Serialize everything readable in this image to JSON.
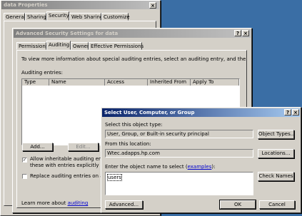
{
  "data_properties": {
    "title": "data Properties",
    "tabs": [
      "General",
      "Sharing",
      "Security",
      "Web Sharing",
      "Customize"
    ],
    "close_glyph": "×"
  },
  "advanced": {
    "title": "Advanced Security Settings for data",
    "help_glyph": "?",
    "close_glyph": "×",
    "tabs": [
      "Permissions",
      "Auditing",
      "Owner",
      "Effective Permissions"
    ],
    "instruction": "To view more information about special auditing entries, select an auditing entry, and then click Edit.",
    "entries_label": "Auditing entries:",
    "columns": [
      "Type",
      "Name",
      "Access",
      "Inherited From",
      "Apply To"
    ],
    "add_label": "Add...",
    "edit_label": "Edit...",
    "inherit_text_1": "Allow inheritable auditing entries fr",
    "inherit_text_2": "these with entries explicitly defined",
    "replace_text": "Replace auditing entries on all chi",
    "learn_text": "Learn more about ",
    "learn_link": "auditing"
  },
  "select_dialog": {
    "title": "Select User, Computer, or Group",
    "help_glyph": "?",
    "close_glyph": "×",
    "object_type_label": "Select this object type:",
    "object_type_value": "User, Group, or Built-in security principal",
    "object_types_button": "Object Types...",
    "location_label": "From this location:",
    "location_value": "Wtec.adapps.hp.com",
    "locations_button": "Locations...",
    "enter_label": "Enter the object name to select (",
    "examples_link": "examples",
    "enter_label_end": "):",
    "object_name_value": "users",
    "check_names_button": "Check Names",
    "advanced_button": "Advanced...",
    "ok_button": "OK",
    "cancel_button": "Cancel"
  }
}
